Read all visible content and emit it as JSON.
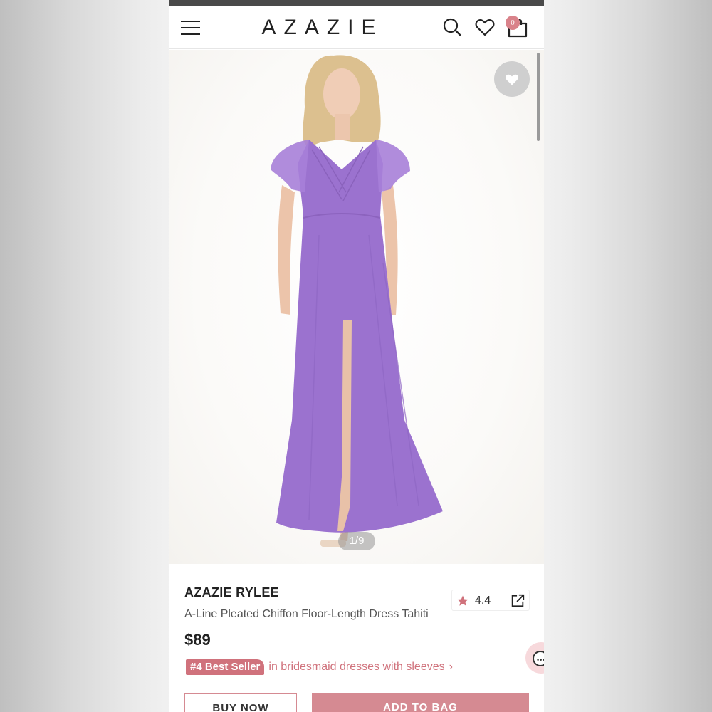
{
  "header": {
    "brand": "AZAZIE",
    "bag_count": "0"
  },
  "gallery": {
    "counter": "1/9",
    "dress_color": "#9b72cf"
  },
  "product": {
    "name": "AZAZIE RYLEE",
    "description": "A-Line Pleated Chiffon Floor-Length Dress Tahiti",
    "price": "$89",
    "rating": "4.4",
    "best_seller_badge": "#4 Best Seller",
    "best_seller_category": "in bridesmaid dresses with sleeves"
  },
  "actions": {
    "buy_now": "BUY NOW",
    "add_to_bag": "ADD TO BAG"
  },
  "colors": {
    "accent": "#d0727c",
    "button_pink": "#d58a92"
  },
  "icons": [
    "menu-icon",
    "search-icon",
    "heart-icon",
    "bag-icon",
    "star-icon",
    "share-icon",
    "chevron-right-icon",
    "chat-icon"
  ]
}
